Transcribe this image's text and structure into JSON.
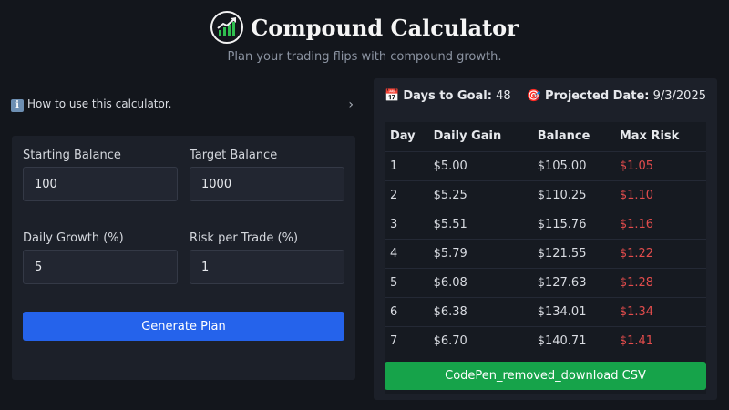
{
  "header": {
    "title": "Compound Calculator",
    "subtitle": "Plan your trading flips with compound growth.",
    "logo_icon": "trending-up-chart-icon"
  },
  "howto": {
    "icon": "ℹ️",
    "label": "How to use this calculator.",
    "chevron": "›"
  },
  "form": {
    "starting_balance": {
      "label": "Starting Balance",
      "value": "100"
    },
    "target_balance": {
      "label": "Target Balance",
      "value": "1000"
    },
    "daily_growth": {
      "label": "Daily Growth (%)",
      "value": "5"
    },
    "risk_per_trade": {
      "label": "Risk per Trade (%)",
      "value": "1"
    },
    "generate_label": "Generate Plan"
  },
  "stats": {
    "days_icon": "📅",
    "days_label": "Days to Goal:",
    "days_value": "48",
    "date_icon": "🎯",
    "date_label": "Projected Date:",
    "date_value": "9/3/2025"
  },
  "table": {
    "headers": [
      "Day",
      "Daily Gain",
      "Balance",
      "Max Risk"
    ],
    "rows": [
      [
        "1",
        "$5.00",
        "$105.00",
        "$1.05"
      ],
      [
        "2",
        "$5.25",
        "$110.25",
        "$1.10"
      ],
      [
        "3",
        "$5.51",
        "$115.76",
        "$1.16"
      ],
      [
        "4",
        "$5.79",
        "$121.55",
        "$1.22"
      ],
      [
        "5",
        "$6.08",
        "$127.63",
        "$1.28"
      ],
      [
        "6",
        "$6.38",
        "$134.01",
        "$1.34"
      ],
      [
        "7",
        "$6.70",
        "$140.71",
        "$1.41"
      ]
    ]
  },
  "csv_label": "CodePen_removed_download CSV",
  "colors": {
    "background": "#13161c",
    "card": "#1c2029",
    "primary_button": "#2563eb",
    "csv_button": "#16a34a",
    "risk_text": "#e24c4c"
  }
}
